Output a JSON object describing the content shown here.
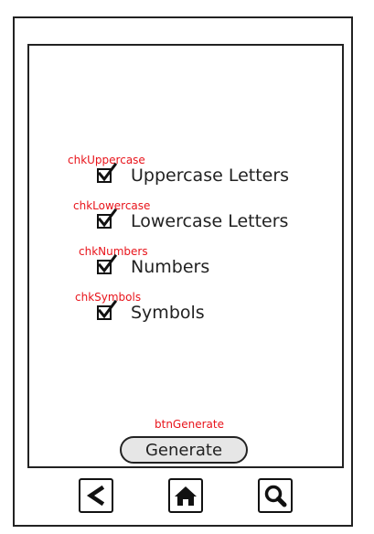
{
  "screen": {
    "checkboxes": [
      {
        "annotation": "chkUppercase",
        "label": "Uppercase Letters",
        "checked": true
      },
      {
        "annotation": "chkLowercase",
        "label": "Lowercase Letters",
        "checked": true
      },
      {
        "annotation": "chkNumbers",
        "label": "Numbers",
        "checked": true
      },
      {
        "annotation": "chkSymbols",
        "label": "Symbols",
        "checked": true
      }
    ],
    "generate_button": {
      "annotation": "btnGenerate",
      "label": "Generate"
    }
  },
  "nav_bar": {
    "icons": [
      "back-icon",
      "home-icon",
      "search-icon"
    ]
  },
  "colors": {
    "annotation": "#e8141b",
    "button_fill": "#e6e6e6",
    "outline": "#222222"
  }
}
